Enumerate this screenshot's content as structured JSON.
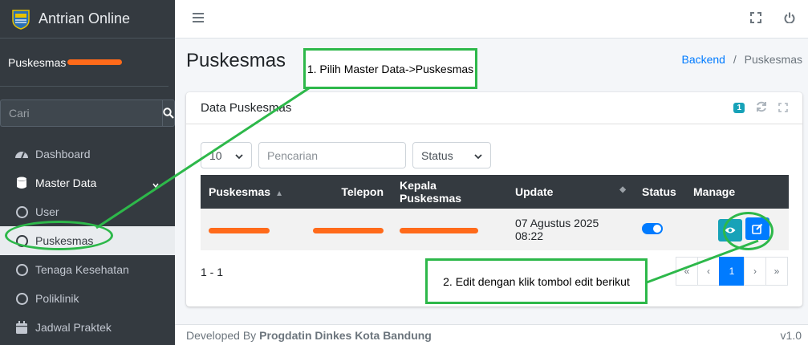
{
  "sidebar": {
    "brand": "Antrian Online",
    "user_name": "Puskesmas",
    "search_placeholder": "Cari",
    "items": [
      {
        "label": "Dashboard"
      },
      {
        "label": "Master Data"
      },
      {
        "label": "User"
      },
      {
        "label": "Puskesmas"
      },
      {
        "label": "Tenaga Kesehatan"
      },
      {
        "label": "Poliklinik"
      },
      {
        "label": "Jadwal Praktek"
      }
    ]
  },
  "header": {
    "page_title": "Puskesmas",
    "breadcrumb": {
      "root": "Backend",
      "separator": "/",
      "current": "Puskesmas"
    }
  },
  "card": {
    "title": "Data Puskesmas",
    "badge": "1",
    "page_length": "10",
    "search_placeholder": "Pencarian",
    "status_filter": "Status",
    "columns": [
      "Puskesmas",
      "Telepon",
      "Kepala Puskesmas",
      "Update",
      "Status",
      "Manage"
    ],
    "rows": [
      {
        "update": "07 Agustus 2025 08:22",
        "status_on": true
      }
    ],
    "page_info": "1 - 1",
    "pagination": [
      "«",
      "‹",
      "1",
      "›",
      "»"
    ]
  },
  "footer": {
    "prefix": "Developed By",
    "org": "Progdatin Dinkes Kota Bandung",
    "version": "v1.0"
  },
  "annotations": {
    "step1": "1. Pilih Master Data->Puskesmas",
    "step2": "2. Edit dengan klik tombol edit berikut",
    "color": "#2db84a"
  },
  "colors": {
    "sidebar_bg": "#343a40",
    "primary": "#007bff",
    "info": "#17a2b8",
    "redaction": "#ff6a1a"
  }
}
